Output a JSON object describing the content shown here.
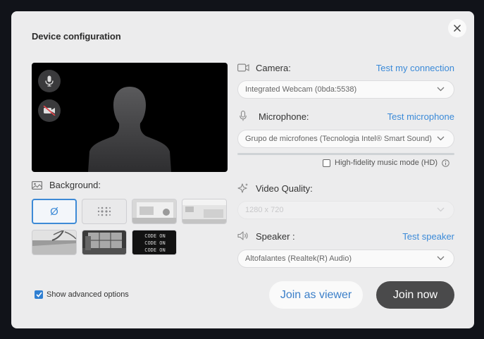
{
  "dialog": {
    "title": "Device configuration"
  },
  "preview": {
    "mic_icon": "microphone-icon",
    "cam_icon": "camera-off-icon"
  },
  "background": {
    "label": "Background:",
    "options": [
      {
        "name": "none",
        "symbol": "Ø",
        "selected": true
      },
      {
        "name": "blur"
      },
      {
        "name": "room-1"
      },
      {
        "name": "room-2"
      },
      {
        "name": "beach"
      },
      {
        "name": "office-window"
      },
      {
        "name": "code-screen",
        "lines": [
          "CODE ON",
          "CODE ON",
          "CODE ON"
        ]
      }
    ]
  },
  "camera": {
    "label": "Camera:",
    "link": "Test my connection",
    "value": "Integrated Webcam (0bda:5538)"
  },
  "microphone": {
    "label": "Microphone:",
    "link": "Test microphone",
    "value": "Grupo de microfones (Tecnologia Intel® Smart Sound)"
  },
  "hifi": {
    "label": "High-fidelity music mode (HD)",
    "checked": false
  },
  "video_quality": {
    "label": "Video Quality:",
    "value": "1280 x 720"
  },
  "speaker": {
    "label": "Speaker :",
    "link": "Test speaker",
    "value": "Altofalantes (Realtek(R) Audio)"
  },
  "advanced": {
    "label": "Show advanced options",
    "checked": true
  },
  "actions": {
    "viewer_label": "Join as viewer",
    "join_label": "Join now"
  },
  "colors": {
    "accent": "#3b8ad8",
    "primary_button": "#4a4a4b",
    "dialog_bg": "#ececed"
  }
}
